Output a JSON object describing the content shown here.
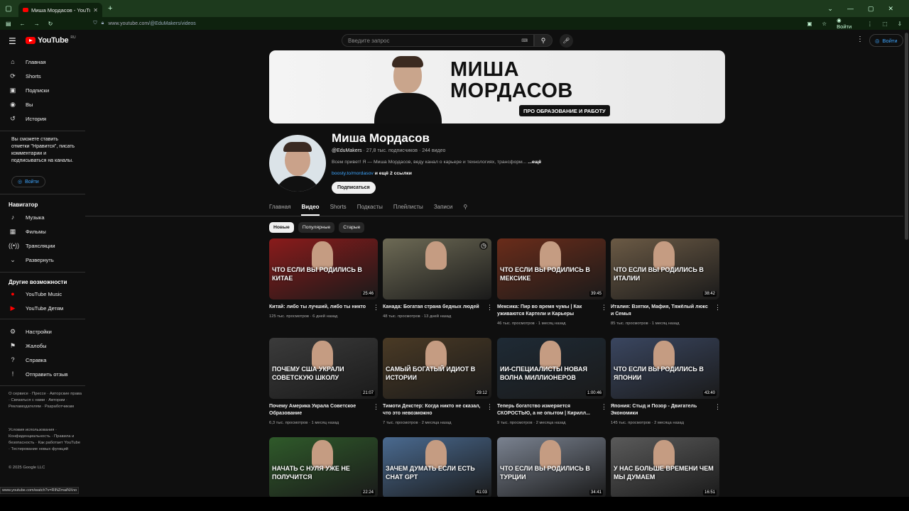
{
  "browser": {
    "tab_title": "Миша Мордасов - YouTube",
    "url_host": "www.youtube.com",
    "url_path": "/@EduMakers/videos",
    "signin_label": "Войти"
  },
  "sidebar": {
    "logo": "YouTube",
    "logo_region": "RU",
    "main": [
      {
        "icon": "home-icon",
        "label": "Главная"
      },
      {
        "icon": "shorts-icon",
        "label": "Shorts"
      },
      {
        "icon": "subscriptions-icon",
        "label": "Подписки"
      },
      {
        "icon": "you-icon",
        "label": "Вы"
      },
      {
        "icon": "history-icon",
        "label": "История"
      }
    ],
    "prompt": "Вы сможете ставить отметки \"Нравится\", писать комментарии и подписываться на каналы.",
    "login_label": "Войти",
    "navigator_title": "Навигатор",
    "navigator": [
      {
        "icon": "music-icon",
        "label": "Музыка"
      },
      {
        "icon": "film-icon",
        "label": "Фильмы"
      },
      {
        "icon": "live-icon",
        "label": "Трансляции"
      },
      {
        "icon": "chevron-down-icon",
        "label": "Развернуть"
      }
    ],
    "other_title": "Другие возможности",
    "other": [
      {
        "icon": "youtube-music-icon",
        "label": "YouTube Music"
      },
      {
        "icon": "youtube-kids-icon",
        "label": "YouTube Детям"
      }
    ],
    "settings": [
      {
        "icon": "gear-icon",
        "label": "Настройки"
      },
      {
        "icon": "flag-icon",
        "label": "Жалобы"
      },
      {
        "icon": "help-icon",
        "label": "Справка"
      },
      {
        "icon": "feedback-icon",
        "label": "Отправить отзыв"
      }
    ],
    "footer1": "О сервисе · Прессе · Авторские права · Связаться с нами · Авторам · Рекламодателям · Разработчикам",
    "footer2": "Условия использования · Конфиденциальность · Правила и безопасность · Как работает YouTube · Тестирование новых функций",
    "copyright": "© 2025 Google LLC"
  },
  "header": {
    "search_placeholder": "Введите запрос",
    "signin_label": "Войти"
  },
  "channel": {
    "banner_name_line1": "МИША",
    "banner_name_line2": "МОРДАСОВ",
    "banner_tag": "ПРО ОБРАЗОВАНИЕ И РАБОТУ",
    "name": "Миша Мордасов",
    "handle": "@EduMakers",
    "subscribers": "27,8 тыс. подписчиков",
    "videos_count": "244 видео",
    "description": "Всем привет! Я — Миша Мордасов, веду канал о карьере и технологиях, трансформ...",
    "more_label": "...ещё",
    "link": "boosty.to/mordasov",
    "more_links": "и ещё 2 ссылки",
    "subscribe_label": "Подписаться"
  },
  "tabs": [
    "Главная",
    "Видео",
    "Shorts",
    "Подкасты",
    "Плейлисты",
    "Записи"
  ],
  "active_tab": "Видео",
  "chips": [
    "Новые",
    "Популярные",
    "Старые"
  ],
  "active_chip": "Новые",
  "videos": [
    {
      "title": "Китай: либо ты лучший, либо ты никто",
      "views": "125 тыс. просмотров",
      "age": "6 дней назад",
      "duration": "25:46",
      "caption": "ЧТО ЕСЛИ ВЫ РОДИЛИСЬ В КИТАЕ",
      "color": "#8a1b1b"
    },
    {
      "title": "Канада: Богатая страна бедных людей",
      "views": "48 тыс. просмотров",
      "age": "13 дней назад",
      "duration": "",
      "caption": "",
      "color": "#6d6a55"
    },
    {
      "title": "Мексика: Пир во время чумы | Как уживаются Картели и Карьеры",
      "views": "46 тыс. просмотров",
      "age": "1 месяц назад",
      "duration": "39:45",
      "caption": "ЧТО ЕСЛИ ВЫ РОДИЛИСЬ В МЕКСИКЕ",
      "color": "#6a2c1a"
    },
    {
      "title": "Италия: Взятки, Мафия, Тяжёлый люкс и Семья",
      "views": "85 тыс. просмотров",
      "age": "1 месяц назад",
      "duration": "38:42",
      "caption": "ЧТО ЕСЛИ ВЫ РОДИЛИСЬ В ИТАЛИИ",
      "color": "#6b5a45"
    },
    {
      "title": "Почему Америка Украла Советское Образование",
      "views": "6,3 тыс. просмотров",
      "age": "1 месяц назад",
      "duration": "21:07",
      "caption": "ПОЧЕМУ США УКРАЛИ СОВЕТСКУЮ ШКОЛУ",
      "color": "#3b3b3b"
    },
    {
      "title": "Тимоти Декстер: Когда никто не сказал, что это невозможно",
      "views": "7 тыс. просмотров",
      "age": "2 месяца назад",
      "duration": "29:12",
      "caption": "САМЫЙ БОГАТЫЙ ИДИОТ В ИСТОРИИ",
      "color": "#4a3a25"
    },
    {
      "title": "Теперь богатство измеряется СКОРОСТЬЮ, а не опытом | Кирилл...",
      "views": "9 тыс. просмотров",
      "age": "2 месяца назад",
      "duration": "1:00:46",
      "caption": "ИИ-СПЕЦИАЛИСТЫ НОВАЯ ВОЛНА МИЛЛИОНЕРОВ",
      "color": "#1e2a35"
    },
    {
      "title": "Япония: Стыд и Позор - Двигатель Экономики",
      "views": "145 тыс. просмотров",
      "age": "2 месяца назад",
      "duration": "43:40",
      "caption": "ЧТО ЕСЛИ ВЫ РОДИЛИСЬ В ЯПОНИИ",
      "color": "#3a4660"
    },
    {
      "title": "",
      "views": "",
      "age": "",
      "duration": "22:24",
      "caption": "НАЧАТЬ С НУЛЯ УЖЕ НЕ ПОЛУЧИТСЯ",
      "color": "#2f5a2a"
    },
    {
      "title": "",
      "views": "",
      "age": "",
      "duration": "41:03",
      "caption": "ЗАЧЕМ ДУМАТЬ ЕСЛИ ЕСТЬ CHAT GPT",
      "color": "#4a6a90"
    },
    {
      "title": "",
      "views": "",
      "age": "",
      "duration": "34:41",
      "caption": "ЧТО ЕСЛИ ВЫ РОДИЛИСЬ В ТУРЦИИ",
      "color": "#7a8290"
    },
    {
      "title": "",
      "views": "",
      "age": "",
      "duration": "16:51",
      "caption": "У НАС БОЛЬШЕ ВРЕМЕНИ ЧЕМ МЫ ДУМАЕМ",
      "color": "#5a5a5a"
    }
  ],
  "status_url": "www.youtube.com/watch?v=RINZmaiNXno"
}
